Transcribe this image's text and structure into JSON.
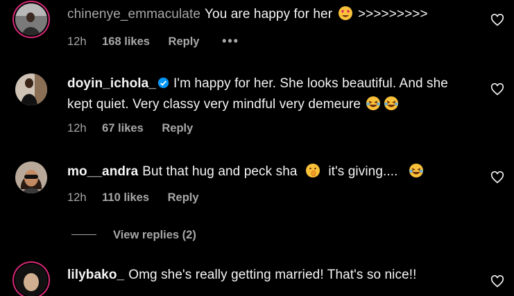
{
  "comments": [
    {
      "username": "chinenye_emmaculate",
      "text": "You are happy for her",
      "suffix": ">>>>>>>>>",
      "time": "12h",
      "likes": "168 likes",
      "reply": "Reply",
      "more": "•••"
    },
    {
      "username": "doyin_ichola_",
      "verified": true,
      "text": "I'm happy for her. She looks beautiful. And she kept quiet. Very classy very mindful very demeure",
      "time": "12h",
      "likes": "67 likes",
      "reply": "Reply"
    },
    {
      "username": "mo__andra",
      "text": "But that hug and peck sha",
      "text2": "it's giving....",
      "time": "12h",
      "likes": "110 likes",
      "reply": "Reply"
    },
    {
      "username": "lilybako_",
      "text": "Omg she's really getting married! That's so nice!!"
    }
  ],
  "view_replies": "View replies (2)",
  "colors": {
    "background": "#000000",
    "text": "#f5f5f5",
    "muted": "#a8a8a8",
    "verified": "#0095f6",
    "story_ring": "#d62976"
  },
  "icons": [
    "heart-outline-icon",
    "verified-badge-icon",
    "heart-eyes-emoji",
    "laughing-emoji",
    "shushing-emoji"
  ]
}
